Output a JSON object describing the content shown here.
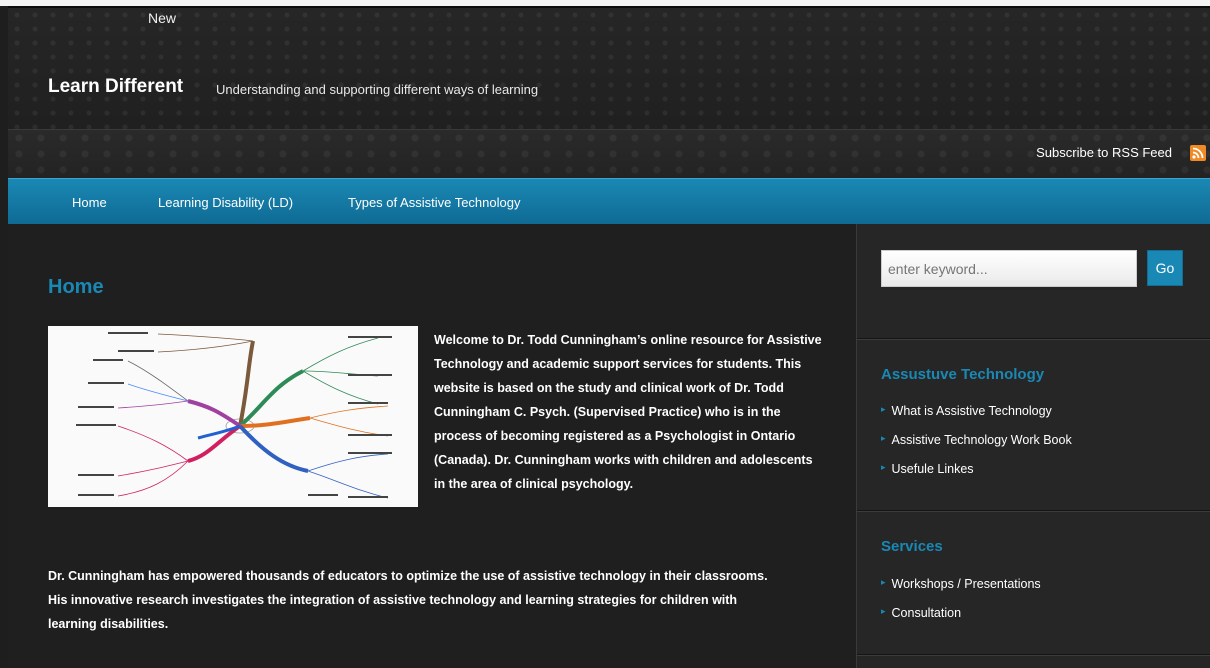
{
  "header": {
    "new_label": "New",
    "title": "Learn Different",
    "tagline": "Understanding and supporting different ways of learning"
  },
  "subbar": {
    "rss_label": "Subscribe to RSS Feed",
    "rss_icon": "rss-icon"
  },
  "nav": {
    "items": [
      "Home",
      "Learning Disability (LD)",
      "Types of Assistive Technology"
    ]
  },
  "main": {
    "title": "Home",
    "intro": "Welcome to Dr. Todd Cunningham’s online resource for Assistive Technology and academic support services for students. This website is based on the study and clinical work of Dr. Todd Cunningham C. Psych. (Supervised Practice) who is in the process of becoming registered as a Psychologist in Ontario (Canada). Dr. Cunningham works with children and adolescents in the area of clinical psychology.",
    "paragraph2": "Dr. Cunningham has empowered thousands of educators to optimize the use of assistive technology in their classrooms. His innovative research investigates the integration of assistive technology and learning strategies for children with learning disabilities."
  },
  "sidebar": {
    "search_placeholder": "enter keyword...",
    "go_label": "Go",
    "widgets": [
      {
        "title": "Assustuve Technology",
        "links": [
          "What is Assistive Technology",
          "Assistive Technology Work Book",
          "Usefule Linkes"
        ]
      },
      {
        "title": "Services",
        "links": [
          "Workshops / Presentations",
          "Consultation"
        ]
      }
    ]
  },
  "colors": {
    "accent": "#1a88b4",
    "background": "#1f1f1f",
    "rss": "#f08a24"
  }
}
